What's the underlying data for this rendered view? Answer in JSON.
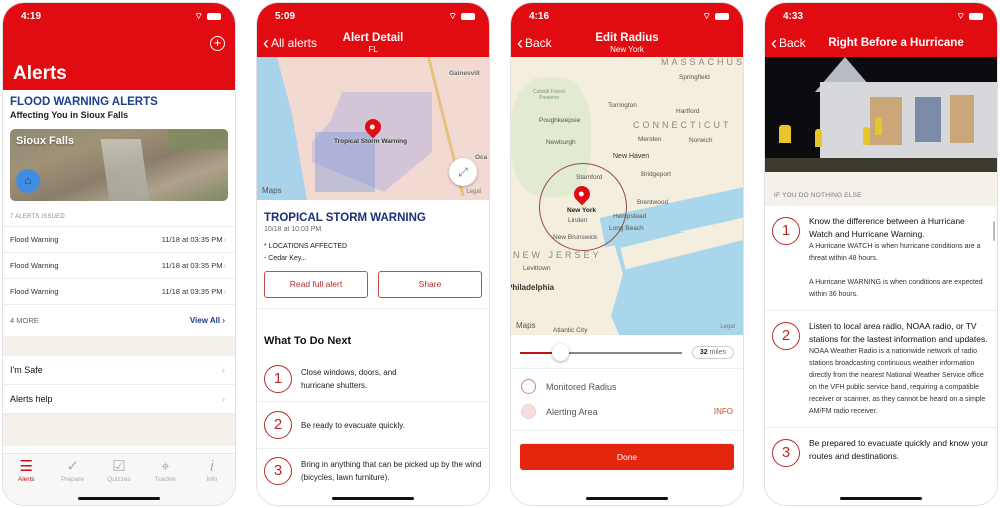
{
  "colors": {
    "brand_red": "#e10b12",
    "title_blue": "#1c3f8f",
    "accent_dark_red": "#b52b2b"
  },
  "screens": [
    {
      "status_time": "4:19",
      "header_title": "Alerts",
      "add_icon": "plus-circle-icon",
      "section_title": "FLOOD WARNING ALERTS",
      "section_subtitle": "Affecting You in Sioux Falls",
      "hero_label": "Sioux Falls",
      "hero_badge_icon": "flood-house-icon",
      "alerts_issued": "7 ALERTS ISSUED",
      "alerts": [
        {
          "name": "Flood Warning",
          "time": "11/18 at 03:35 PM"
        },
        {
          "name": "Flood Warning",
          "time": "11/18 at 03:35 PM"
        },
        {
          "name": "Flood Warning",
          "time": "11/18 at 03:35 PM"
        }
      ],
      "more_count": "4 MORE",
      "view_all": "View All",
      "links": [
        "I'm Safe",
        "Alerts help"
      ],
      "tabs": [
        {
          "label": "Alerts",
          "icon": "list-icon",
          "active": true
        },
        {
          "label": "Prepare",
          "icon": "checkmark-icon",
          "active": false
        },
        {
          "label": "Quizzes",
          "icon": "checkbox-icon",
          "active": false
        },
        {
          "label": "Tracker",
          "icon": "map-pin-icon",
          "active": false
        },
        {
          "label": "Info",
          "icon": "info-icon",
          "active": false
        }
      ]
    },
    {
      "status_time": "5:09",
      "back_label": "All alerts",
      "nav_title": "Alert Detail",
      "nav_subtitle": "FL",
      "map_labels": {
        "pin": "Tropical Storm Warning",
        "city1": "Gainesvill",
        "city2": "Oca",
        "maps": "Maps",
        "legal": "Legal"
      },
      "alert_title": "TROPICAL STORM WARNING",
      "alert_date": "10/18 at 10:03 PM",
      "locations_heading": "* LOCATIONS AFFECTED",
      "locations_value": "- Cedar Key...",
      "read_full_label": "Read full alert",
      "share_label": "Share",
      "next_heading": "What To Do Next",
      "steps": [
        {
          "n": "1",
          "text": "Close windows, doors, and hurricane shutters."
        },
        {
          "n": "2",
          "text": "Be ready to evacuate quickly."
        },
        {
          "n": "3",
          "text": "Bring in anything that can be picked up by the wind (bicycles, lawn furniture)."
        }
      ]
    },
    {
      "status_time": "4:16",
      "back_label": "Back",
      "nav_title": "Edit Radius",
      "nav_subtitle": "New York",
      "map_labels": {
        "springfield": "Springfield",
        "catskill": "Catskill Forest Preserve",
        "torrington": "Torrington",
        "hartford": "Hartford",
        "poughkeepsie": "Poughkeepsie",
        "connecticut": "CONNECTICUT",
        "newburgh": "Newburgh",
        "meriden": "Meriden",
        "norwich": "Norwich",
        "new_haven": "New Haven",
        "stamford": "Stamford",
        "bridgeport": "Bridgeport",
        "new_york": "New York",
        "brentwood": "Brentwood",
        "linden": "Linden",
        "hempstead": "Hempstead",
        "long_beach": "Long Beach",
        "new_brunswick": "New Brunswick",
        "new_jersey": "NEW JERSEY",
        "levittown": "Levittown",
        "philadelphia": "Philadelphia",
        "atlantic_city": "Atlantic City",
        "massachusetts": "MASSACHUS",
        "maps": "Maps",
        "legal": "Legal"
      },
      "radius_value": "32",
      "radius_unit": "miles",
      "slider_fraction": 0.25,
      "monitored_label": "Monitored Radius",
      "alerting_label": "Alerting Area",
      "info_label": "INFO",
      "done_label": "Done"
    },
    {
      "status_time": "4:33",
      "back_label": "Back",
      "nav_title": "Right Before a Hurricane",
      "section_header": "IF YOU DO NOTHING ELSE",
      "steps": [
        {
          "n": "1",
          "heading": "Know the difference between a Hurricane Watch and Hurricane Warning.",
          "body": "A Hurricane WATCH is when hurricane conditions are a threat within 48 hours.\n\nA Hurricane WARNING is when conditions are expected within 36 hours."
        },
        {
          "n": "2",
          "heading": "Listen to local area radio, NOAA radio, or TV stations for the lastest information and updates.",
          "body": "NOAA Weather Radio is a nationwide network of radio stations broadcasting continuous weather information directly from the nearest National Weather Service office on the VFH public service band, requiring a compatible receiver or scanner, as they cannot be heard on a simple AM/FM radio receiver."
        },
        {
          "n": "3",
          "heading": "Be prepared to evacuate quickly and know your routes and destinations.",
          "body": ""
        }
      ]
    }
  ]
}
